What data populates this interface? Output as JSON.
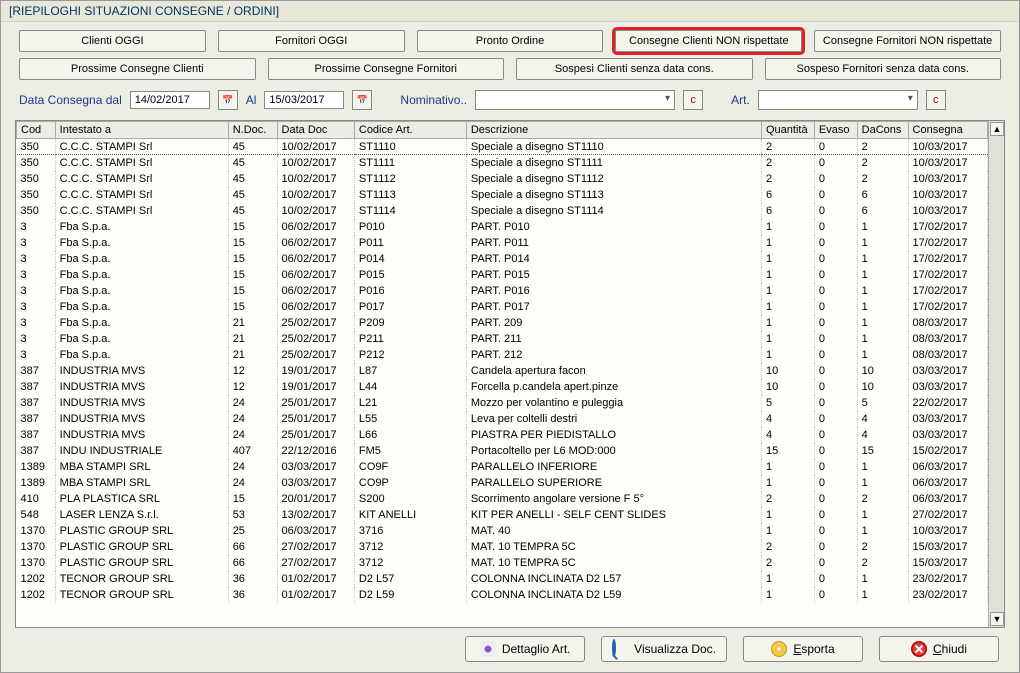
{
  "title": "[RIEPILOGHI SITUAZIONI CONSEGNE / ORDINI]",
  "tabsRow1": {
    "clienti_oggi": "Clienti OGGI",
    "fornitori_oggi": "Fornitori OGGI",
    "pronto_ordine": "Pronto Ordine",
    "cons_clienti_non": "Consegne Clienti NON rispettate",
    "cons_fornitori_non": "Consegne Fornitori NON rispettate"
  },
  "tabsRow2": {
    "prossime_clienti": "Prossime Consegne Clienti",
    "prossime_fornitori": "Prossime Consegne Fornitori",
    "sospesi_clienti": "Sospesi Clienti senza data cons.",
    "sospeso_fornitori": "Sospeso Fornitori senza data cons."
  },
  "filters": {
    "data_consegna_dal": "Data Consegna dal",
    "date_from": "14/02/2017",
    "al": "Al",
    "date_to": "15/03/2017",
    "nominativo": "Nominativo..",
    "art": "Art.",
    "c": "c"
  },
  "columns": {
    "cod": "Cod",
    "intestato": "Intestato a",
    "ndoc": "N.Doc.",
    "datadoc": "Data Doc",
    "codart": "Codice Art.",
    "descr": "Descrizione",
    "quantita": "Quantità",
    "evaso": "Evaso",
    "dacons": "DaCons",
    "consegna": "Consegna"
  },
  "rows": [
    {
      "cod": "350",
      "name": "C.C.C. STAMPI Srl",
      "ndoc": "45",
      "ddoc": "10/02/2017",
      "cart": "ST1110",
      "desc": "Speciale a disegno ST1110",
      "qta": "2",
      "ev": "0",
      "dc": "2",
      "cons": "10/03/2017"
    },
    {
      "cod": "350",
      "name": "C.C.C. STAMPI Srl",
      "ndoc": "45",
      "ddoc": "10/02/2017",
      "cart": "ST1111",
      "desc": "Speciale a disegno ST1111",
      "qta": "2",
      "ev": "0",
      "dc": "2",
      "cons": "10/03/2017"
    },
    {
      "cod": "350",
      "name": "C.C.C. STAMPI Srl",
      "ndoc": "45",
      "ddoc": "10/02/2017",
      "cart": "ST1112",
      "desc": "Speciale a disegno ST1112",
      "qta": "2",
      "ev": "0",
      "dc": "2",
      "cons": "10/03/2017"
    },
    {
      "cod": "350",
      "name": "C.C.C. STAMPI Srl",
      "ndoc": "45",
      "ddoc": "10/02/2017",
      "cart": "ST1113",
      "desc": "Speciale a disegno ST1113",
      "qta": "6",
      "ev": "0",
      "dc": "6",
      "cons": "10/03/2017"
    },
    {
      "cod": "350",
      "name": "C.C.C. STAMPI Srl",
      "ndoc": "45",
      "ddoc": "10/02/2017",
      "cart": "ST1114",
      "desc": "Speciale a disegno ST1114",
      "qta": "6",
      "ev": "0",
      "dc": "6",
      "cons": "10/03/2017"
    },
    {
      "cod": "3",
      "name": "Fba S.p.a.",
      "ndoc": "15",
      "ddoc": "06/02/2017",
      "cart": "P010",
      "desc": "PART. P010",
      "qta": "1",
      "ev": "0",
      "dc": "1",
      "cons": "17/02/2017"
    },
    {
      "cod": "3",
      "name": "Fba S.p.a.",
      "ndoc": "15",
      "ddoc": "06/02/2017",
      "cart": "P011",
      "desc": "PART. P011",
      "qta": "1",
      "ev": "0",
      "dc": "1",
      "cons": "17/02/2017"
    },
    {
      "cod": "3",
      "name": "Fba S.p.a.",
      "ndoc": "15",
      "ddoc": "06/02/2017",
      "cart": "P014",
      "desc": "PART. P014",
      "qta": "1",
      "ev": "0",
      "dc": "1",
      "cons": "17/02/2017"
    },
    {
      "cod": "3",
      "name": "Fba S.p.a.",
      "ndoc": "15",
      "ddoc": "06/02/2017",
      "cart": "P015",
      "desc": "PART. P015",
      "qta": "1",
      "ev": "0",
      "dc": "1",
      "cons": "17/02/2017"
    },
    {
      "cod": "3",
      "name": "Fba S.p.a.",
      "ndoc": "15",
      "ddoc": "06/02/2017",
      "cart": "P016",
      "desc": "PART. P016",
      "qta": "1",
      "ev": "0",
      "dc": "1",
      "cons": "17/02/2017"
    },
    {
      "cod": "3",
      "name": "Fba S.p.a.",
      "ndoc": "15",
      "ddoc": "06/02/2017",
      "cart": "P017",
      "desc": "PART. P017",
      "qta": "1",
      "ev": "0",
      "dc": "1",
      "cons": "17/02/2017"
    },
    {
      "cod": "3",
      "name": "Fba S.p.a.",
      "ndoc": "21",
      "ddoc": "25/02/2017",
      "cart": "P209",
      "desc": "PART. 209",
      "qta": "1",
      "ev": "0",
      "dc": "1",
      "cons": "08/03/2017"
    },
    {
      "cod": "3",
      "name": "Fba S.p.a.",
      "ndoc": "21",
      "ddoc": "25/02/2017",
      "cart": "P211",
      "desc": "PART. 211",
      "qta": "1",
      "ev": "0",
      "dc": "1",
      "cons": "08/03/2017"
    },
    {
      "cod": "3",
      "name": "Fba S.p.a.",
      "ndoc": "21",
      "ddoc": "25/02/2017",
      "cart": "P212",
      "desc": "PART. 212",
      "qta": "1",
      "ev": "0",
      "dc": "1",
      "cons": "08/03/2017"
    },
    {
      "cod": "387",
      "name": "INDUSTRIA  MVS",
      "ndoc": "12",
      "ddoc": "19/01/2017",
      "cart": "L87",
      "desc": "Candela apertura facon",
      "qta": "10",
      "ev": "0",
      "dc": "10",
      "cons": "03/03/2017"
    },
    {
      "cod": "387",
      "name": "INDUSTRIA  MVS",
      "ndoc": "12",
      "ddoc": "19/01/2017",
      "cart": "L44",
      "desc": "Forcella p.candela apert.pinze",
      "qta": "10",
      "ev": "0",
      "dc": "10",
      "cons": "03/03/2017"
    },
    {
      "cod": "387",
      "name": "INDUSTRIA  MVS",
      "ndoc": "24",
      "ddoc": "25/01/2017",
      "cart": "L21",
      "desc": "Mozzo per volantino e puleggia",
      "qta": "5",
      "ev": "0",
      "dc": "5",
      "cons": "22/02/2017"
    },
    {
      "cod": "387",
      "name": "INDUSTRIA  MVS",
      "ndoc": "24",
      "ddoc": "25/01/2017",
      "cart": "L55",
      "desc": "Leva per coltelli destri",
      "qta": "4",
      "ev": "0",
      "dc": "4",
      "cons": "03/03/2017"
    },
    {
      "cod": "387",
      "name": "INDUSTRIA  MVS",
      "ndoc": "24",
      "ddoc": "25/01/2017",
      "cart": "L66",
      "desc": "PIASTRA PER PIEDISTALLO",
      "qta": "4",
      "ev": "0",
      "dc": "4",
      "cons": "03/03/2017"
    },
    {
      "cod": "387",
      "name": "INDU INDUSTRIALE",
      "ndoc": "407",
      "ddoc": "22/12/2016",
      "cart": "FM5",
      "desc": "Portacoltello per L6 MOD:000",
      "qta": "15",
      "ev": "0",
      "dc": "15",
      "cons": "15/02/2017"
    },
    {
      "cod": "1389",
      "name": "MBA STAMPI SRL",
      "ndoc": "24",
      "ddoc": "03/03/2017",
      "cart": "CO9F",
      "desc": "PARALLELO INFERIORE",
      "qta": "1",
      "ev": "0",
      "dc": "1",
      "cons": "06/03/2017"
    },
    {
      "cod": "1389",
      "name": "MBA STAMPI SRL",
      "ndoc": "24",
      "ddoc": "03/03/2017",
      "cart": "CO9P",
      "desc": "PARALLELO SUPERIORE",
      "qta": "1",
      "ev": "0",
      "dc": "1",
      "cons": "06/03/2017"
    },
    {
      "cod": "410",
      "name": "PLA  PLASTICA SRL",
      "ndoc": "15",
      "ddoc": "20/01/2017",
      "cart": "S200",
      "desc": "Scorrimento angolare versione F 5°",
      "qta": "2",
      "ev": "0",
      "dc": "2",
      "cons": "06/03/2017"
    },
    {
      "cod": "548",
      "name": "LASER LENZA S.r.l.",
      "ndoc": "53",
      "ddoc": "13/02/2017",
      "cart": "KIT ANELLI",
      "desc": "KIT PER ANELLI - SELF CENT  SLIDES",
      "qta": "1",
      "ev": "0",
      "dc": "1",
      "cons": "27/02/2017"
    },
    {
      "cod": "1370",
      "name": "PLASTIC GROUP SRL",
      "ndoc": "25",
      "ddoc": "06/03/2017",
      "cart": "3716",
      "desc": "MAT. 40",
      "qta": "1",
      "ev": "0",
      "dc": "1",
      "cons": "10/03/2017"
    },
    {
      "cod": "1370",
      "name": "PLASTIC GROUP SRL",
      "ndoc": "66",
      "ddoc": "27/02/2017",
      "cart": "3712",
      "desc": "MAT. 10 TEMPRA 5C",
      "qta": "2",
      "ev": "0",
      "dc": "2",
      "cons": "15/03/2017"
    },
    {
      "cod": "1370",
      "name": "PLASTIC GROUP SRL",
      "ndoc": "66",
      "ddoc": "27/02/2017",
      "cart": "3712",
      "desc": "MAT. 10 TEMPRA 5C",
      "qta": "2",
      "ev": "0",
      "dc": "2",
      "cons": "15/03/2017"
    },
    {
      "cod": "1202",
      "name": "TECNOR GROUP SRL",
      "ndoc": "36",
      "ddoc": "01/02/2017",
      "cart": "D2 L57",
      "desc": "COLONNA INCLINATA D2 L57",
      "qta": "1",
      "ev": "0",
      "dc": "1",
      "cons": "23/02/2017"
    },
    {
      "cod": "1202",
      "name": "TECNOR GROUP SRL",
      "ndoc": "36",
      "ddoc": "01/02/2017",
      "cart": "D2 L59",
      "desc": "COLONNA INCLINATA D2 L59",
      "qta": "1",
      "ev": "0",
      "dc": "1",
      "cons": "23/02/2017"
    }
  ],
  "actions": {
    "dettaglio": "Dettaglio Art.",
    "visualizza": "Visualizza Doc.",
    "esporta": "Esporta",
    "chiudi": "Chiudi"
  }
}
